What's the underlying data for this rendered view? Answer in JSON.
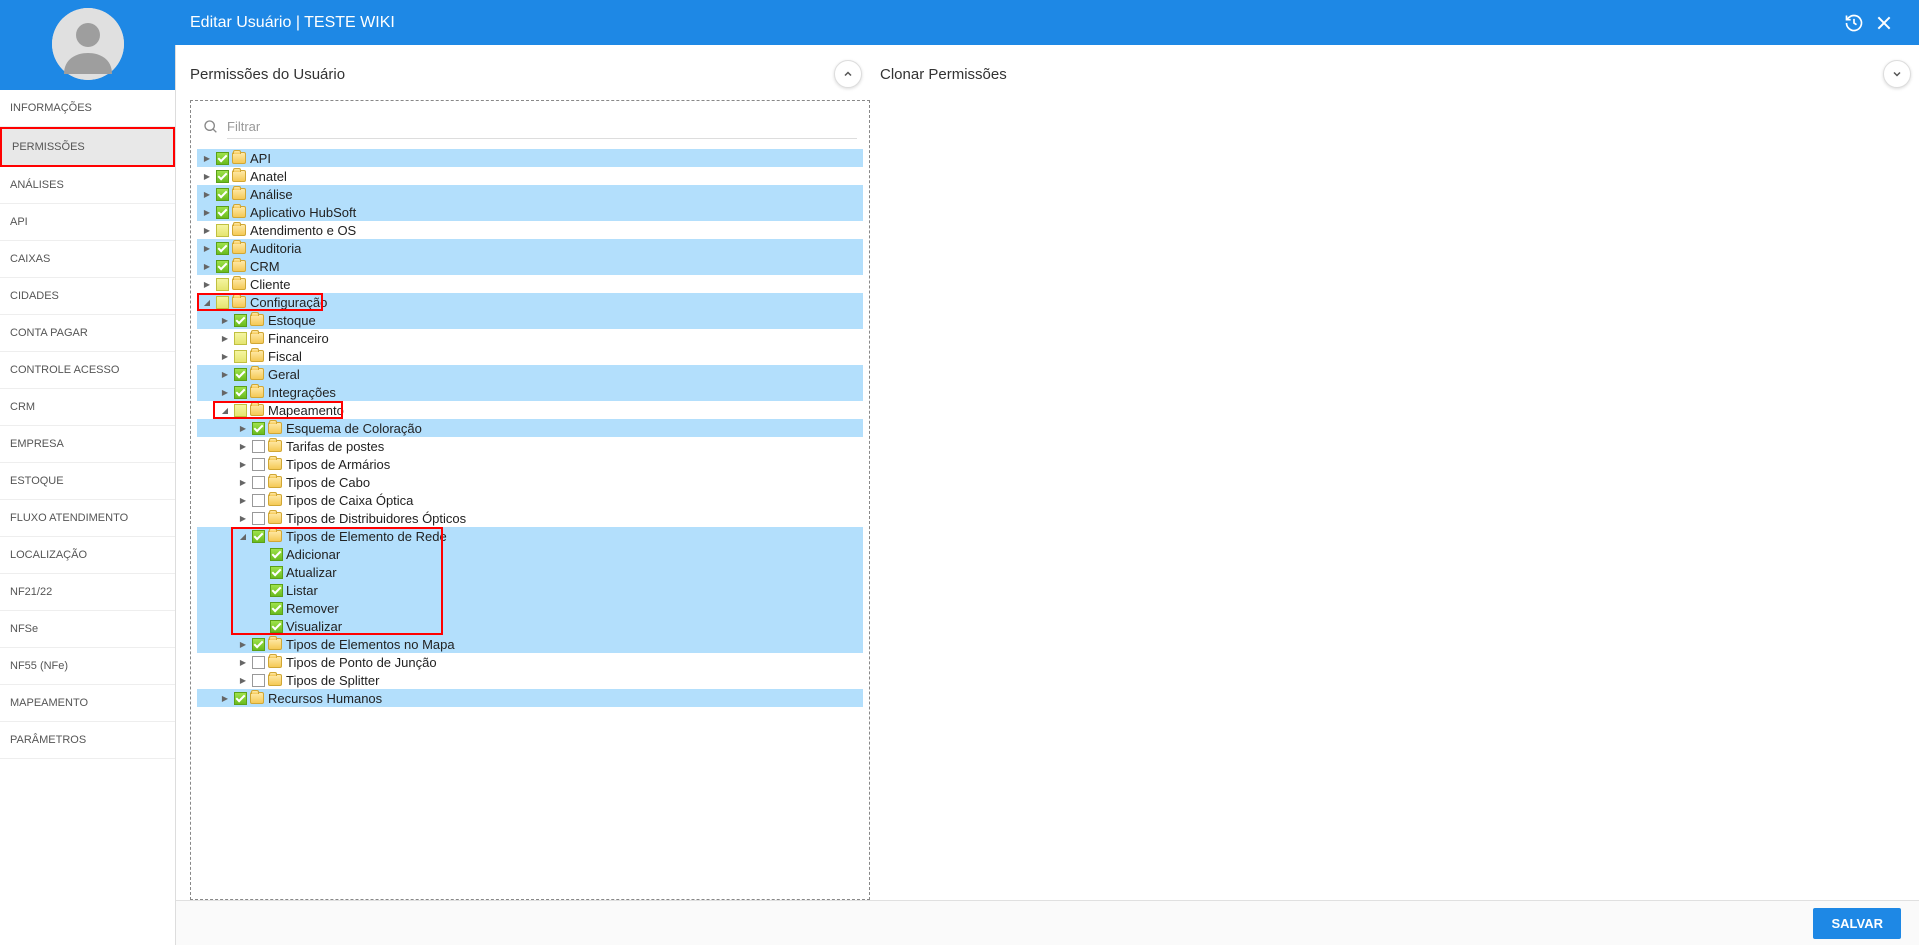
{
  "header": {
    "title": "Editar Usuário | TESTE WIKI"
  },
  "sidebar": {
    "items": [
      {
        "label": "INFORMAÇÕES",
        "active": false
      },
      {
        "label": "PERMISSÕES",
        "active": true,
        "highlighted": true
      },
      {
        "label": "ANÁLISES"
      },
      {
        "label": "API"
      },
      {
        "label": "CAIXAS"
      },
      {
        "label": "CIDADES"
      },
      {
        "label": "CONTA PAGAR"
      },
      {
        "label": "CONTROLE ACESSO"
      },
      {
        "label": "CRM"
      },
      {
        "label": "EMPRESA"
      },
      {
        "label": "ESTOQUE"
      },
      {
        "label": "FLUXO ATENDIMENTO"
      },
      {
        "label": "LOCALIZAÇÃO"
      },
      {
        "label": "NF21/22"
      },
      {
        "label": "NFSe"
      },
      {
        "label": "NF55 (NFe)"
      },
      {
        "label": "MAPEAMENTO"
      },
      {
        "label": "PARÂMETROS"
      }
    ]
  },
  "panels": {
    "permissions_title": "Permissões do Usuário",
    "clone_title": "Clonar Permissões",
    "filter_placeholder": "Filtrar"
  },
  "tree": [
    {
      "indent": 0,
      "toggle": "▶",
      "chk": "green",
      "folder": true,
      "label": "API",
      "sel": true
    },
    {
      "indent": 0,
      "toggle": "▶",
      "chk": "green",
      "folder": true,
      "label": "Anatel",
      "sel": false
    },
    {
      "indent": 0,
      "toggle": "▶",
      "chk": "green",
      "folder": true,
      "label": "Análise",
      "sel": true
    },
    {
      "indent": 0,
      "toggle": "▶",
      "chk": "green",
      "folder": true,
      "label": "Aplicativo HubSoft",
      "sel": true
    },
    {
      "indent": 0,
      "toggle": "▶",
      "chk": "partial",
      "folder": true,
      "label": "Atendimento e OS",
      "sel": false
    },
    {
      "indent": 0,
      "toggle": "▶",
      "chk": "green",
      "folder": true,
      "label": "Auditoria",
      "sel": true
    },
    {
      "indent": 0,
      "toggle": "▶",
      "chk": "green",
      "folder": true,
      "label": "CRM",
      "sel": true
    },
    {
      "indent": 0,
      "toggle": "▶",
      "chk": "partial",
      "folder": true,
      "label": "Cliente",
      "sel": false
    },
    {
      "indent": 0,
      "toggle": "▼",
      "chk": "partial",
      "folder": true,
      "label": "Configuração",
      "sel": true,
      "redbox": "config"
    },
    {
      "indent": 1,
      "toggle": "▶",
      "chk": "green",
      "folder": true,
      "label": "Estoque",
      "sel": true
    },
    {
      "indent": 1,
      "toggle": "▶",
      "chk": "partial",
      "folder": true,
      "label": "Financeiro",
      "sel": false
    },
    {
      "indent": 1,
      "toggle": "▶",
      "chk": "partial",
      "folder": true,
      "label": "Fiscal",
      "sel": false
    },
    {
      "indent": 1,
      "toggle": "▶",
      "chk": "green",
      "folder": true,
      "label": "Geral",
      "sel": true
    },
    {
      "indent": 1,
      "toggle": "▶",
      "chk": "green",
      "folder": true,
      "label": "Integrações",
      "sel": true
    },
    {
      "indent": 1,
      "toggle": "▼",
      "chk": "partial",
      "folder": true,
      "label": "Mapeamento",
      "sel": false,
      "redbox": "map"
    },
    {
      "indent": 2,
      "toggle": "▶",
      "chk": "green",
      "folder": true,
      "label": "Esquema de Coloração",
      "sel": true
    },
    {
      "indent": 2,
      "toggle": "▶",
      "chk": "none",
      "folder": true,
      "label": "Tarifas de postes",
      "sel": false
    },
    {
      "indent": 2,
      "toggle": "▶",
      "chk": "none",
      "folder": true,
      "label": "Tipos de Armários",
      "sel": false
    },
    {
      "indent": 2,
      "toggle": "▶",
      "chk": "none",
      "folder": true,
      "label": "Tipos de Cabo",
      "sel": false
    },
    {
      "indent": 2,
      "toggle": "▶",
      "chk": "none",
      "folder": true,
      "label": "Tipos de Caixa Óptica",
      "sel": false
    },
    {
      "indent": 2,
      "toggle": "▶",
      "chk": "none",
      "folder": true,
      "label": "Tipos de Distribuidores Ópticos",
      "sel": false
    },
    {
      "indent": 2,
      "toggle": "▼",
      "chk": "green",
      "folder": true,
      "label": "Tipos de Elemento de Rede",
      "sel": true,
      "redbox": "ter_start"
    },
    {
      "indent": 3,
      "toggle": "",
      "chk": "green",
      "folder": false,
      "label": "Adicionar",
      "sel": true
    },
    {
      "indent": 3,
      "toggle": "",
      "chk": "green",
      "folder": false,
      "label": "Atualizar",
      "sel": true
    },
    {
      "indent": 3,
      "toggle": "",
      "chk": "green",
      "folder": false,
      "label": "Listar",
      "sel": true
    },
    {
      "indent": 3,
      "toggle": "",
      "chk": "green",
      "folder": false,
      "label": "Remover",
      "sel": true
    },
    {
      "indent": 3,
      "toggle": "",
      "chk": "green",
      "folder": false,
      "label": "Visualizar",
      "sel": true,
      "redbox": "ter_end"
    },
    {
      "indent": 2,
      "toggle": "▶",
      "chk": "green",
      "folder": true,
      "label": "Tipos de Elementos no Mapa",
      "sel": true
    },
    {
      "indent": 2,
      "toggle": "▶",
      "chk": "none",
      "folder": true,
      "label": "Tipos de Ponto de Junção",
      "sel": false
    },
    {
      "indent": 2,
      "toggle": "▶",
      "chk": "none",
      "folder": true,
      "label": "Tipos de Splitter",
      "sel": false
    },
    {
      "indent": 1,
      "toggle": "▶",
      "chk": "green",
      "folder": true,
      "label": "Recursos Humanos",
      "sel": true
    }
  ],
  "footer": {
    "save_label": "SALVAR"
  }
}
